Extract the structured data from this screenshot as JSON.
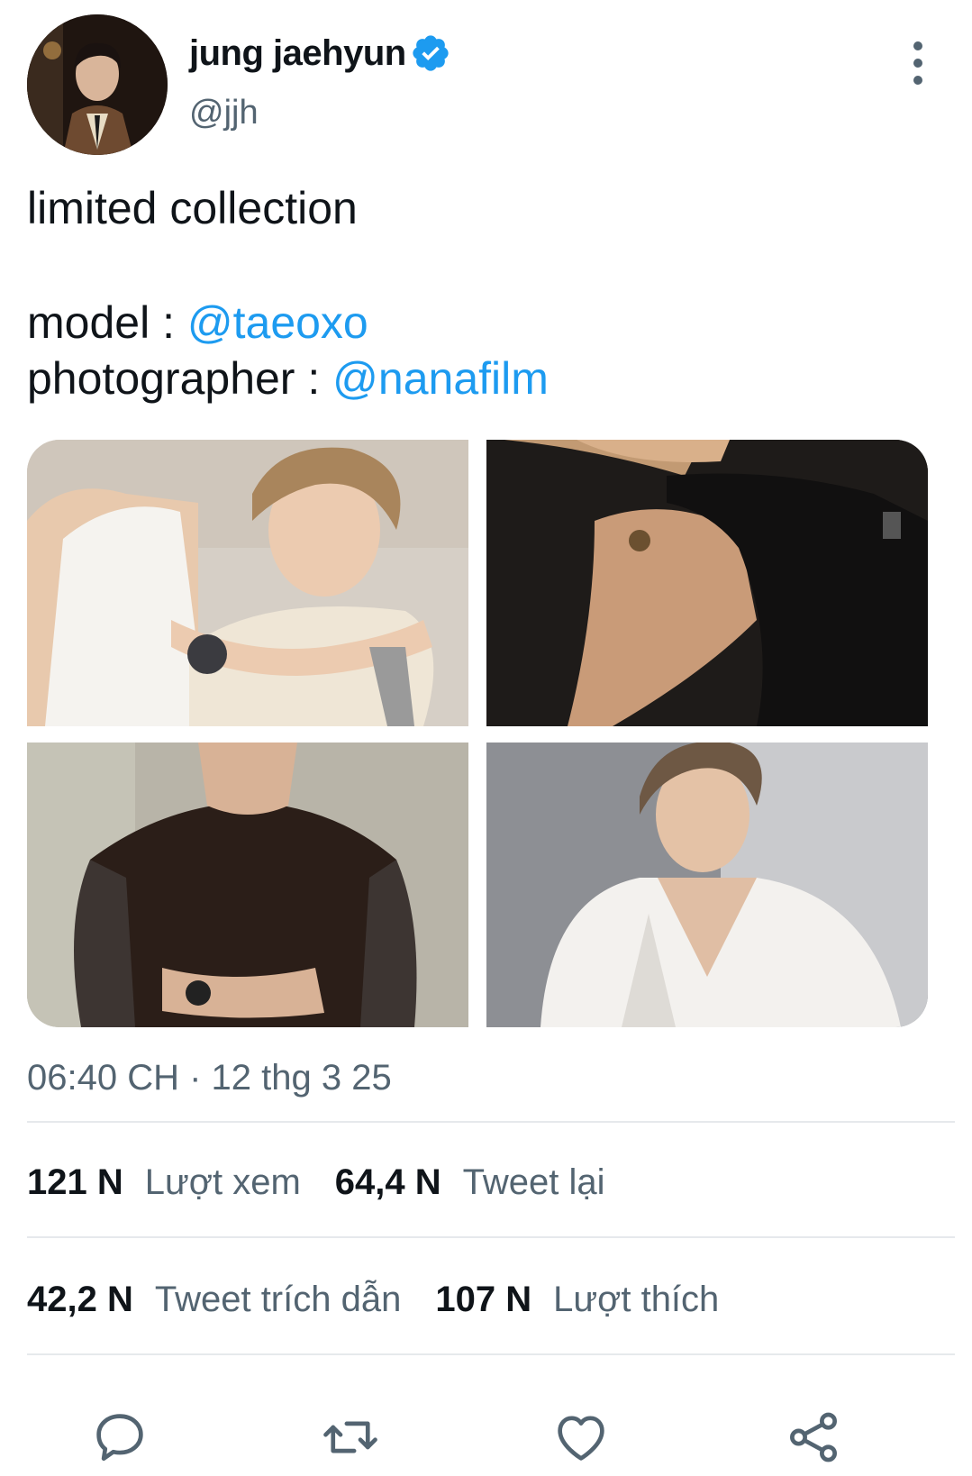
{
  "author": {
    "display_name": "jung jaehyun",
    "handle": "@jjh",
    "verified": true
  },
  "tweet": {
    "text_line1": "limited collection",
    "model_label": "model : ",
    "model_mention": "@taeoxo",
    "photographer_label": "photographer : ",
    "photographer_mention": "@nanafilm"
  },
  "timestamp": "06:40 CH · 12 thg 3 25",
  "stats": {
    "views_count": "121 N",
    "views_label": "Lượt xem",
    "retweets_count": "64,4 N",
    "retweets_label": "Tweet lại",
    "quotes_count": "42,2 N",
    "quotes_label": "Tweet trích dẫn",
    "likes_count": "107 N",
    "likes_label": "Lượt thích"
  },
  "icons": {
    "more": "more-vertical-icon",
    "verified": "verified-badge-icon",
    "reply": "reply-icon",
    "retweet": "retweet-icon",
    "like": "heart-icon",
    "share": "share-icon"
  },
  "colors": {
    "accent": "#1d9bf0",
    "text_primary": "#0f1419",
    "text_secondary": "#536471",
    "divider": "#e6e9ec"
  }
}
